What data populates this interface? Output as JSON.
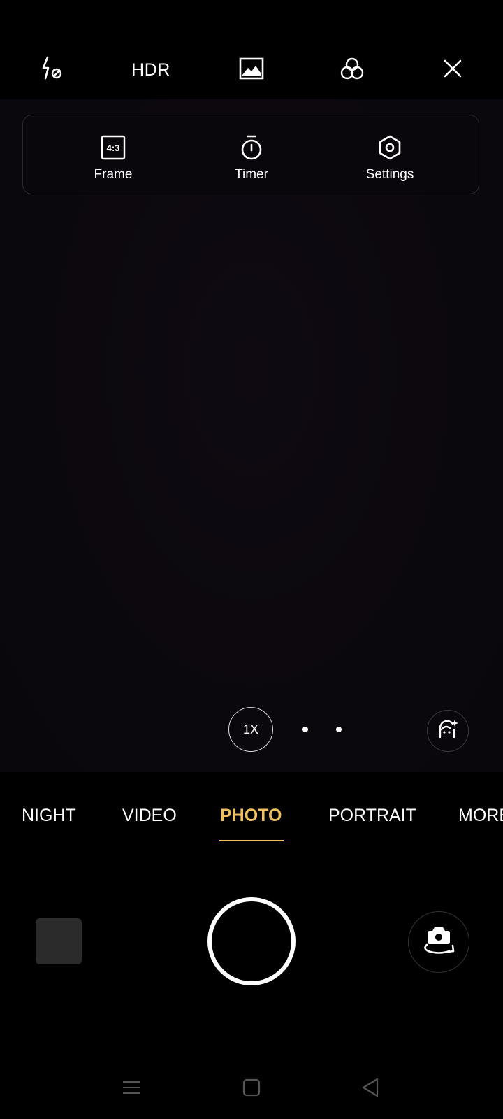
{
  "top_bar": {
    "flash_icon": "flash-off-icon",
    "hdr_label": "HDR",
    "image_icon": "image-icon",
    "filter_icon": "filter-icon",
    "close_icon": "close-icon"
  },
  "quick_panel": {
    "items": [
      {
        "label": "Frame",
        "icon": "aspect-ratio-icon",
        "icon_text": "4:3"
      },
      {
        "label": "Timer",
        "icon": "timer-icon"
      },
      {
        "label": "Settings",
        "icon": "settings-icon"
      }
    ]
  },
  "zoom": {
    "label": "1X"
  },
  "modes": {
    "items": [
      "NIGHT",
      "VIDEO",
      "PHOTO",
      "PORTRAIT",
      "MORE"
    ],
    "active": "PHOTO"
  },
  "colors": {
    "accent": "#f0c060",
    "background": "#000000",
    "viewfinder": "#0b080d"
  }
}
